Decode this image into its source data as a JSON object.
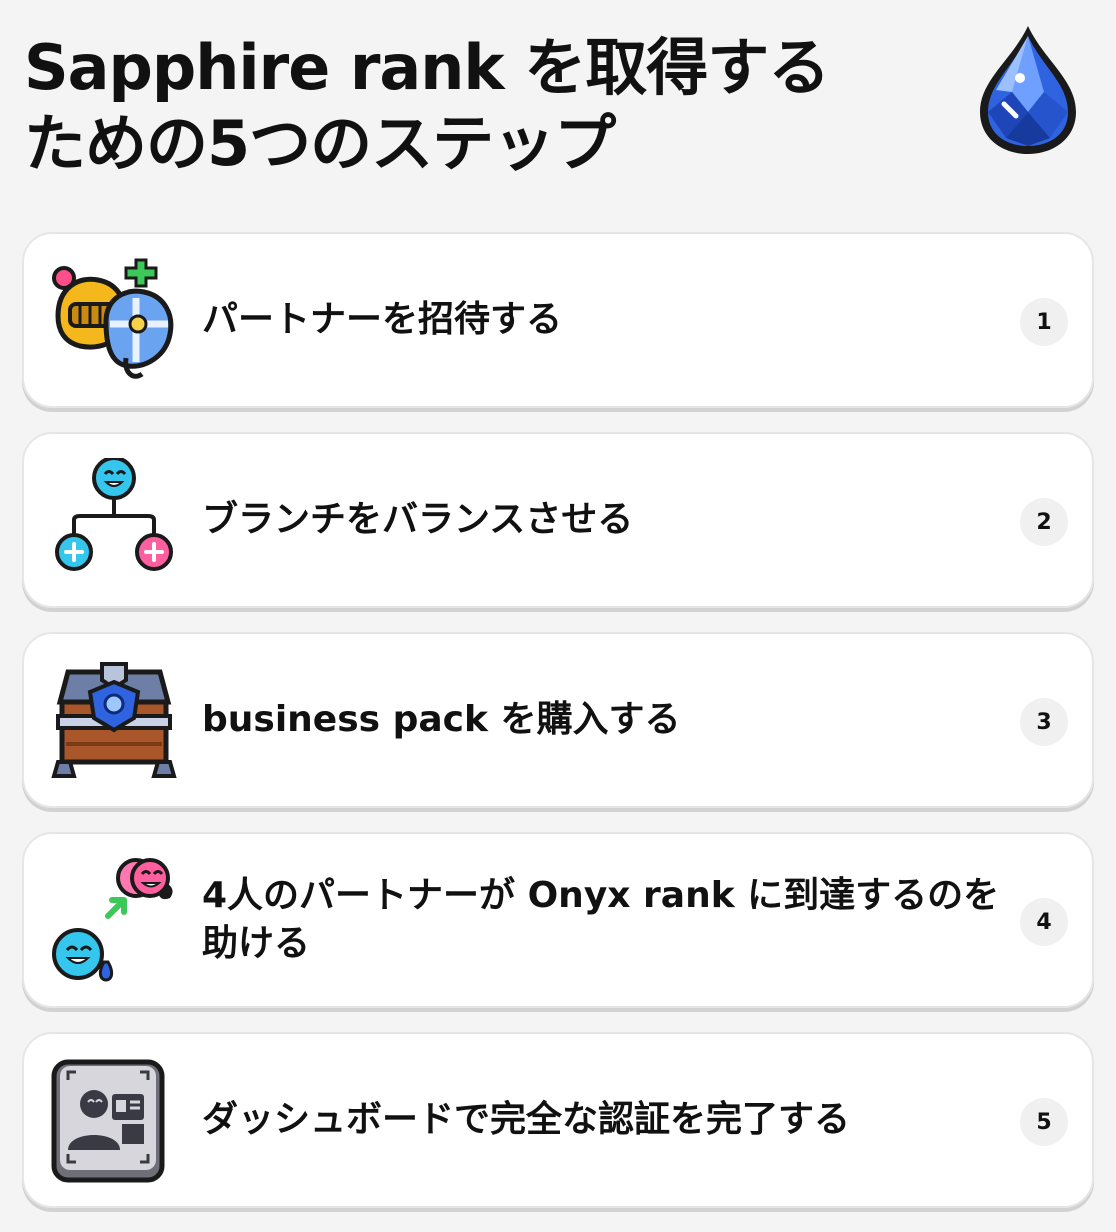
{
  "header": {
    "title": "Sapphire rank を取得するための5つのステップ",
    "icon": "sapphire-gem-icon"
  },
  "colors": {
    "background": "#f4f4f4",
    "card": "#ffffff",
    "badge": "#f0f0f0",
    "gem_blue": "#2f63e0",
    "accent_pink": "#ff5f9e",
    "accent_cyan": "#35c6ee",
    "accent_green": "#3cc95a"
  },
  "steps": [
    {
      "label": "パートナーを招待する",
      "number": "1",
      "icon": "partner-helmets-icon"
    },
    {
      "label": "ブランチをバランスさせる",
      "number": "2",
      "icon": "branch-tree-icon"
    },
    {
      "label": "business pack を購入する",
      "number": "3",
      "icon": "treasure-chest-icon"
    },
    {
      "label": "4人のパートナーが Onyx rank に到達するのを助ける",
      "number": "4",
      "icon": "partners-rank-up-icon"
    },
    {
      "label": "ダッシュボードで完全な認証を完了する",
      "number": "5",
      "icon": "id-verification-icon"
    }
  ]
}
